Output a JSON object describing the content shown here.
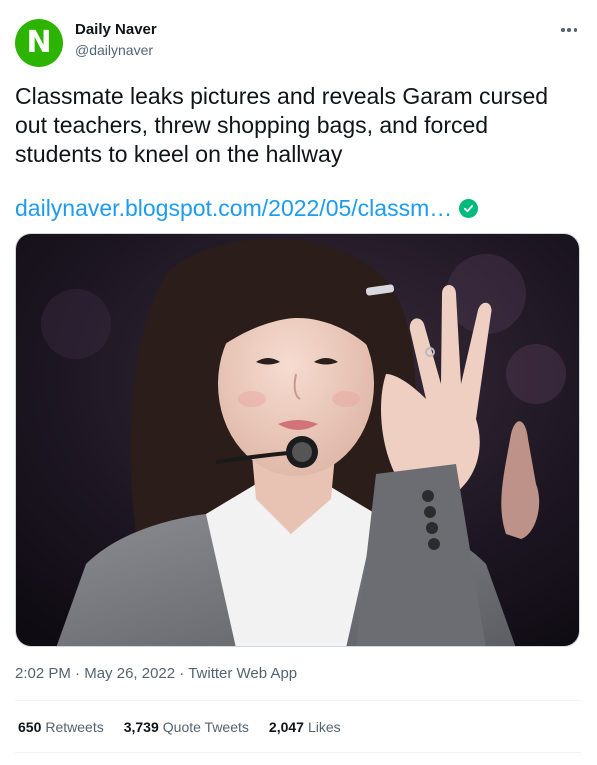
{
  "author": {
    "avatar_letter": "N",
    "avatar_color": "#2db400",
    "display_name": "Daily Naver",
    "handle": "@dailynaver"
  },
  "tweet": {
    "text": "Classmate leaks pictures and reveals Garam cursed\nout teachers, threw shopping bags, and forced\nstudents to kneel on the hallway",
    "link_text": "dailynaver.blogspot.com/2022/05/classm…",
    "link_color": "#1d9bf0"
  },
  "meta": {
    "time": "2:02 PM",
    "date": "May 26, 2022",
    "source": "Twitter Web App",
    "separator": "·"
  },
  "stats": [
    {
      "count": "650",
      "label": "Retweets"
    },
    {
      "count": "3,739",
      "label": "Quote Tweets"
    },
    {
      "count": "2,047",
      "label": "Likes"
    }
  ],
  "icons": {
    "more": "more-dots-icon",
    "verified": "verified-check-icon"
  }
}
